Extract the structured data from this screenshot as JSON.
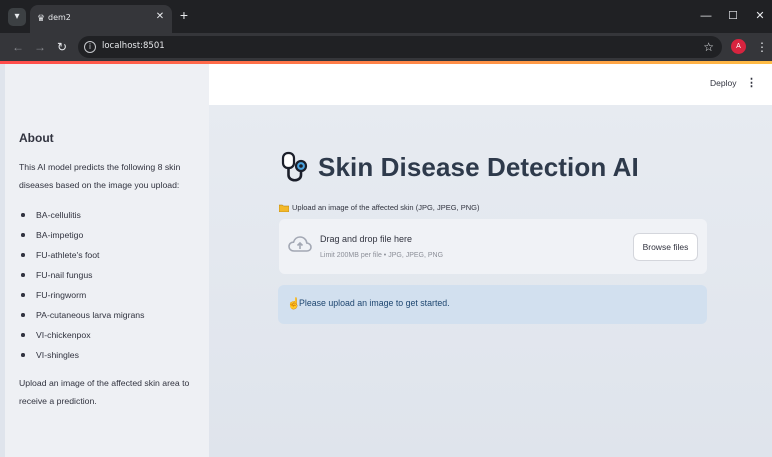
{
  "browser": {
    "tab_title": "dem2",
    "new_tab_symbol": "+",
    "address": "localhost:8501",
    "profile_initial": "A",
    "window_controls": [
      "—",
      "☐",
      "✕"
    ]
  },
  "header": {
    "deploy_label": "Deploy"
  },
  "sidebar": {
    "about_title": "About",
    "intro": "This AI model predicts the following 8 skin diseases based on the image you upload:",
    "diseases": [
      "BA-cellulitis",
      "BA-impetigo",
      "FU-athlete's foot",
      "FU-nail fungus",
      "FU-ringworm",
      "PA-cutaneous larva migrans",
      "VI-chickenpox",
      "VI-shingles"
    ],
    "footer": "Upload an image of the affected skin area to receive a prediction."
  },
  "main": {
    "title": "Skin Disease Detection AI",
    "title_icon": "stethoscope-icon",
    "upload_label": "Upload an image of the affected skin (JPG, JPEG, PNG)",
    "dropzone_title": "Drag and drop file here",
    "dropzone_limit": "Limit 200MB per file • JPG, JPEG, PNG",
    "browse_label": "Browse files",
    "info_message": "Please upload an image to get started."
  },
  "colors": {
    "accent_red": "#ff4b4b",
    "accent_yellow": "#ffbd45",
    "title_text": "#2e3a4b",
    "info_bg": "#d2e0ef",
    "info_text": "#1e4670",
    "profile_avatar": "#d7243f"
  }
}
